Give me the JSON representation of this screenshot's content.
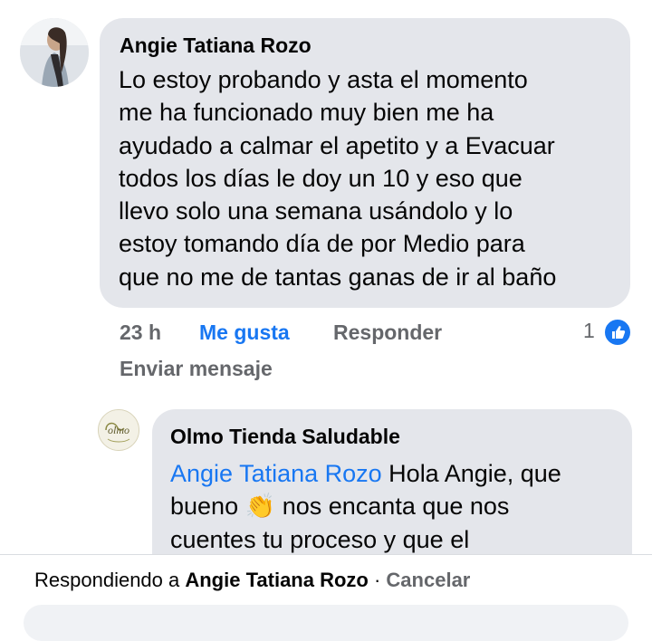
{
  "comment": {
    "author": "Angie Tatiana Rozo",
    "lines": [
      "Lo estoy probando y asta el momento",
      "me ha funcionado muy bien me ha",
      "ayudado a calmar el apetito y a Evacuar",
      "todos los días le doy un 10 y eso que",
      "llevo solo una semana usándolo y lo",
      "estoy tomando día de por Medio para",
      "que no me de tantas ganas de ir al baño"
    ],
    "time": "23 h",
    "like_label": "Me gusta",
    "reply_label": "Responder",
    "send_message_label": "Enviar mensaje",
    "reaction_count": "1",
    "reaction_icon": "like-icon"
  },
  "reply": {
    "author": "Olmo Tienda Saludable",
    "mention": "Angie Tatiana Rozo",
    "line1_rest": " Hola Angie, que",
    "line2_start": "bueno ",
    "emoji": "👏",
    "line2_rest": " nos encanta que nos",
    "line3": "cuentes tu proceso y que el",
    "avatar_text": "olmo"
  },
  "composer": {
    "replying_prefix": "Respondiendo a ",
    "replying_to": "Angie Tatiana Rozo",
    "separator": " · ",
    "cancel_label": "Cancelar"
  },
  "colors": {
    "bubble": "#e4e6eb",
    "accent": "#1877f2",
    "secondary_text": "#65676b"
  }
}
